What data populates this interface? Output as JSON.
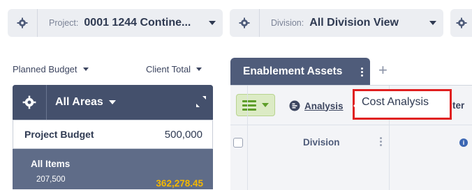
{
  "top_filters": [
    {
      "label": "Project:",
      "value": "0001 1244 Contine..."
    },
    {
      "label": "Division:",
      "value": "All Division View"
    }
  ],
  "left_panel": {
    "planned_budget_label": "Planned Budget",
    "client_total_label": "Client Total",
    "areas_title": "All Areas",
    "project_budget": {
      "label": "Project Budget",
      "value": "500,000"
    },
    "all_items": {
      "label": "All Items",
      "sub_value": "207,500",
      "total": "362,278.45"
    }
  },
  "tab": {
    "label": "Enablement Assets",
    "add_symbol": "+"
  },
  "toolbar": {
    "analysis_link": "Analysis",
    "tooltip": "Cost Analysis",
    "partial_text": "ter"
  },
  "grid": {
    "columns": [
      "Division"
    ]
  },
  "colors": {
    "accent_green": "#5e9e2a",
    "highlight_red": "#e02020",
    "total_yellow": "#f5b800"
  }
}
